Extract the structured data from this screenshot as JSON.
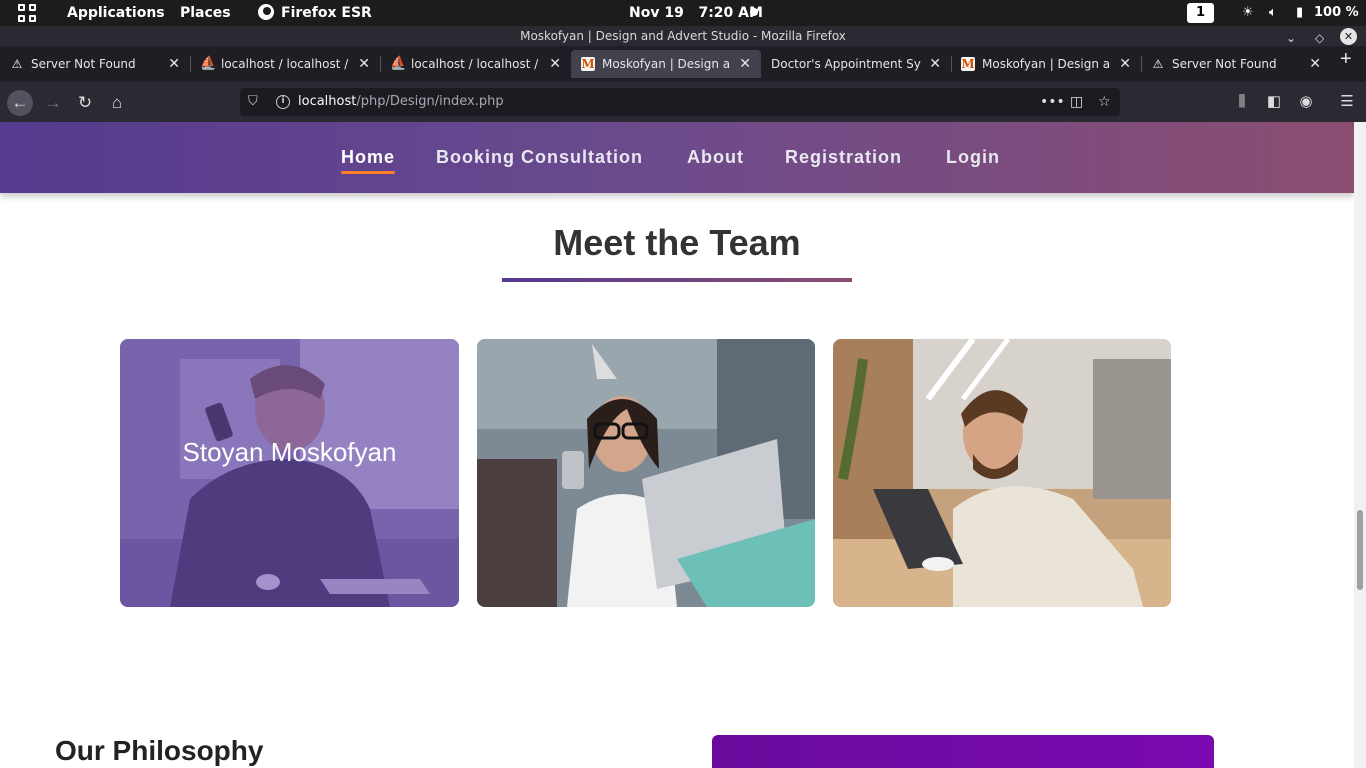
{
  "topbar": {
    "applications": "Applications",
    "places": "Places",
    "browser": "Firefox ESR",
    "date": "Nov 19",
    "time": "7:20 AM",
    "workspace": "1",
    "battery": "100 %"
  },
  "window": {
    "title": "Moskofyan | Design and Advert Studio - Mozilla Firefox",
    "close": "✕"
  },
  "tabs": [
    {
      "label": "Server Not Found",
      "icon": "warning-icon"
    },
    {
      "label": "localhost / localhost / doc",
      "icon": "phpmyadmin-icon"
    },
    {
      "label": "localhost / localhost / cdf",
      "icon": "phpmyadmin-icon"
    },
    {
      "label": "Moskofyan | Design and A",
      "icon": "m-logo-icon"
    },
    {
      "label": "Doctor's Appointment System",
      "icon": ""
    },
    {
      "label": "Moskofyan | Design and A",
      "icon": "m-logo-icon"
    },
    {
      "label": "Server Not Found",
      "icon": "warning-icon"
    }
  ],
  "urlbar": {
    "host": "localhost",
    "path": "/php/Design/index.php"
  },
  "site_nav": {
    "home": "Home",
    "booking": "Booking Consultation",
    "about": "About",
    "registration": "Registration",
    "login": "Login"
  },
  "team": {
    "title": "Meet the Team",
    "members": [
      {
        "name": "Stoyan Moskofyan"
      }
    ]
  },
  "philosophy": {
    "title": "Our Philosophy"
  }
}
